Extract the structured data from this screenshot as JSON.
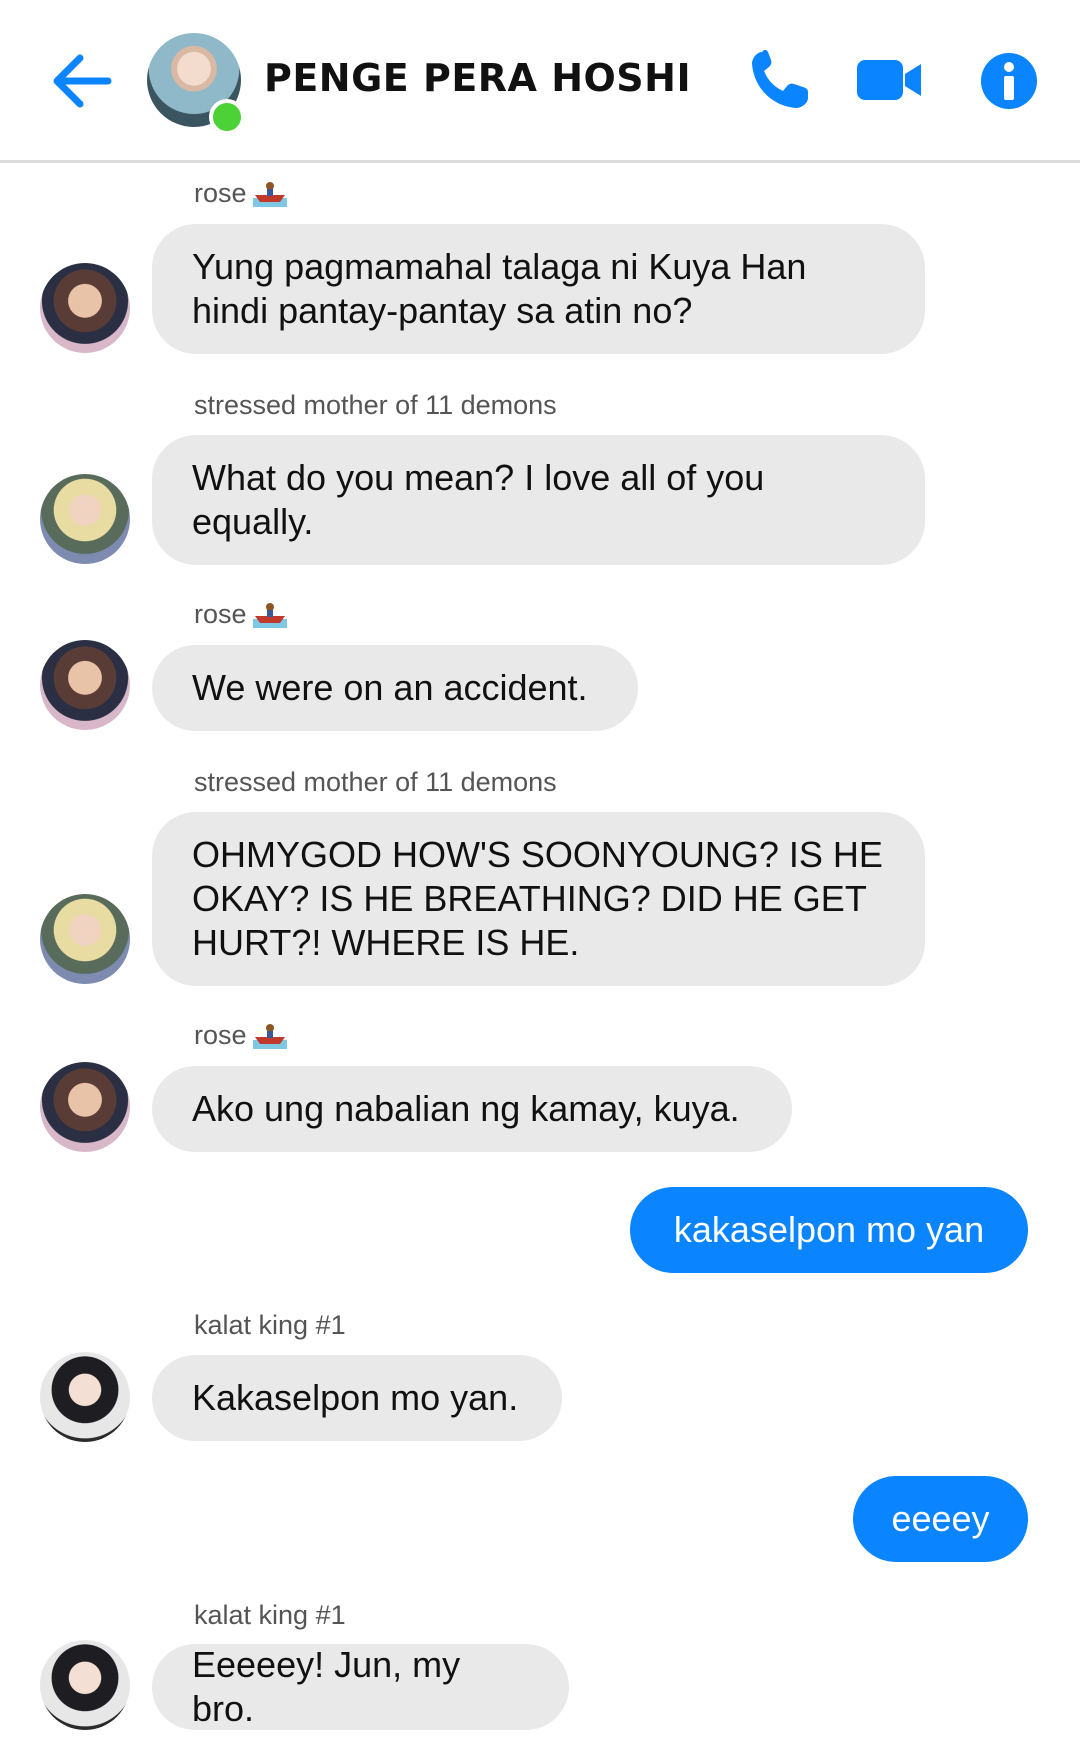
{
  "header": {
    "title": "PENGE PERA HOSHI",
    "accent_color": "#0a84ff",
    "online_color": "#4cd137",
    "icons": [
      "back-arrow-icon",
      "phone-icon",
      "video-camera-icon",
      "info-icon"
    ]
  },
  "messages": [
    {
      "sender": "rose",
      "sender_emoji": "rowboat",
      "text": "Yung pagmamahal talaga ni Kuya Han hindi pantay-pantay sa atin no?"
    },
    {
      "sender": "stressed mother of 11 demons",
      "text": "What do you mean? I love all of you equally."
    },
    {
      "sender": "rose",
      "sender_emoji": "rowboat",
      "text": "We were on an accident."
    },
    {
      "sender": "stressed mother of 11 demons",
      "text": "OHMYGOD HOW'S SOONYOUNG? IS HE OKAY? IS HE BREATHING? DID HE GET HURT?! WHERE IS HE."
    },
    {
      "sender": "rose",
      "sender_emoji": "rowboat",
      "text": "Ako ung nabalian ng kamay, kuya."
    },
    {
      "outgoing": true,
      "text": "kakaselpon mo yan"
    },
    {
      "sender": "kalat king #1",
      "text": "Kakaselpon mo yan."
    },
    {
      "outgoing": true,
      "text": "eeeey"
    },
    {
      "sender": "kalat king #1",
      "text": "Eeeeey! Jun, my bro."
    }
  ]
}
